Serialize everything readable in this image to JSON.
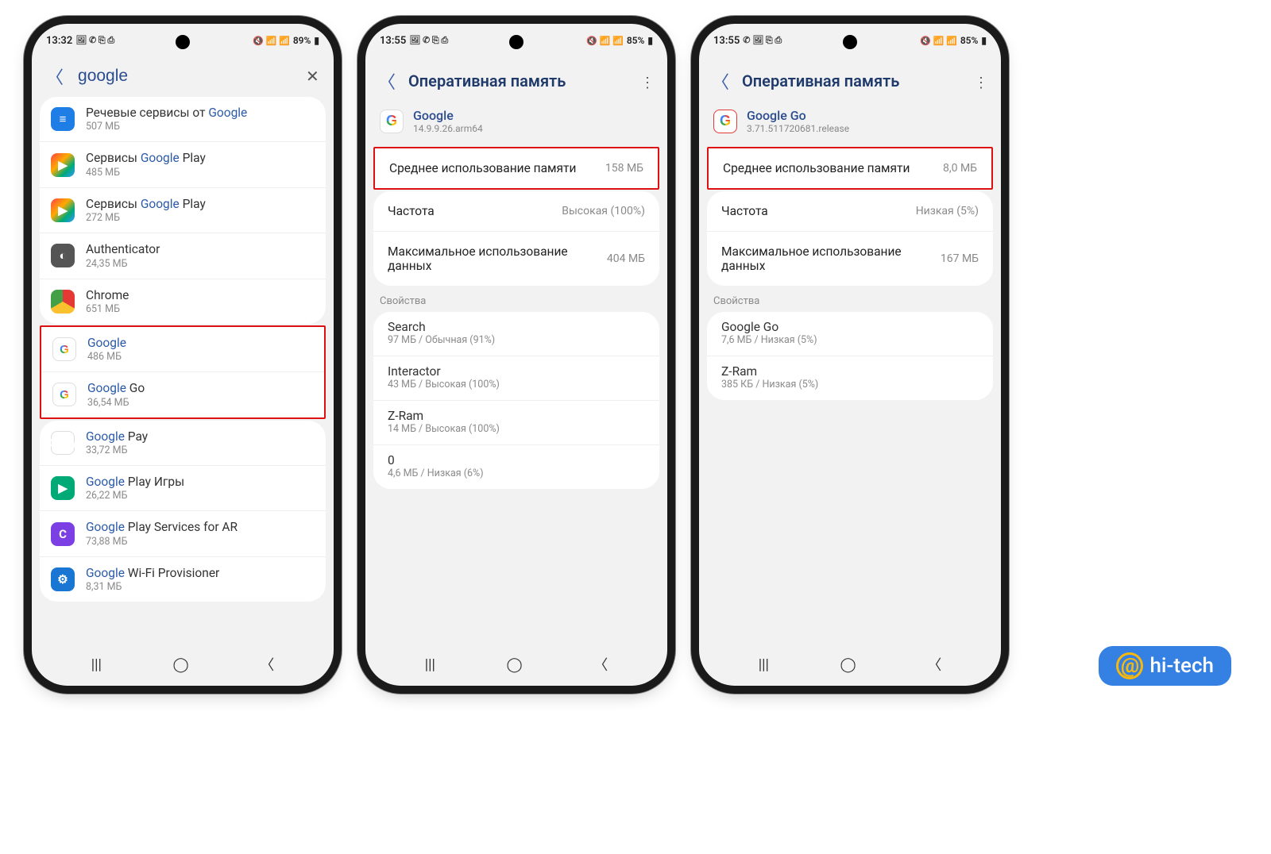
{
  "watermark": "hi-tech",
  "phone1": {
    "status": {
      "time": "13:32",
      "battery": "89%"
    },
    "search": {
      "value": "google"
    },
    "items": [
      {
        "title_pre": "Речевые сервисы от ",
        "title_hl": "Google",
        "title_post": "",
        "sub": "507 МБ",
        "icon": "speech",
        "hl": false
      },
      {
        "title_pre": "Сервисы ",
        "title_hl": "Google",
        "title_post": " Play",
        "sub": "485 МБ",
        "icon": "play",
        "hl": false
      },
      {
        "title_pre": "Сервисы ",
        "title_hl": "Google",
        "title_post": " Play",
        "sub": "272 МБ",
        "icon": "play2",
        "hl": false
      },
      {
        "title_pre": "",
        "title_hl": "",
        "title_post": "Authenticator",
        "sub": "24,35 МБ",
        "icon": "auth",
        "hl": false
      },
      {
        "title_pre": "",
        "title_hl": "",
        "title_post": "Chrome",
        "sub": "651 МБ",
        "icon": "chrome",
        "hl": false
      },
      {
        "title_pre": "",
        "title_hl": "Google",
        "title_post": "",
        "sub": "486 МБ",
        "icon": "google",
        "hl": true
      },
      {
        "title_pre": "",
        "title_hl": "Google",
        "title_post": " Go",
        "sub": "36,54 МБ",
        "icon": "googlego",
        "hl": true
      },
      {
        "title_pre": "",
        "title_hl": "Google",
        "title_post": " Pay",
        "sub": "33,72 МБ",
        "icon": "gpay",
        "hl": false
      },
      {
        "title_pre": "",
        "title_hl": "Google",
        "title_post": " Play Игры",
        "sub": "26,22 МБ",
        "icon": "playg",
        "hl": false
      },
      {
        "title_pre": "",
        "title_hl": "Google",
        "title_post": " Play Services for AR",
        "sub": "73,88 МБ",
        "icon": "ar",
        "hl": false
      },
      {
        "title_pre": "",
        "title_hl": "Google",
        "title_post": " Wi-Fi Provisioner",
        "sub": "8,31 МБ",
        "icon": "prov",
        "hl": false
      }
    ]
  },
  "phone2": {
    "status": {
      "time": "13:55",
      "battery": "85%"
    },
    "title": "Оперативная память",
    "app": {
      "name": "Google",
      "version": "14.9.9.26.arm64"
    },
    "avg": {
      "label": "Среднее использование памяти",
      "value": "158 МБ"
    },
    "freq": {
      "label": "Частота",
      "value": "Высокая (100%)"
    },
    "max": {
      "label": "Максимальное использование данных",
      "value": "404 МБ"
    },
    "section": "Свойства",
    "props": [
      {
        "name": "Search",
        "sub": "97 МБ / Обычная (91%)"
      },
      {
        "name": "Interactor",
        "sub": "43 МБ / Высокая (100%)"
      },
      {
        "name": "Z-Ram",
        "sub": "14 МБ / Высокая (100%)"
      },
      {
        "name": "0",
        "sub": "4,6 МБ / Низкая (6%)"
      }
    ]
  },
  "phone3": {
    "status": {
      "time": "13:55",
      "battery": "85%"
    },
    "title": "Оперативная память",
    "app": {
      "name": "Google Go",
      "version": "3.71.511720681.release"
    },
    "avg": {
      "label": "Среднее использование памяти",
      "value": "8,0 МБ"
    },
    "freq": {
      "label": "Частота",
      "value": "Низкая (5%)"
    },
    "max": {
      "label": "Максимальное использование данных",
      "value": "167 МБ"
    },
    "section": "Свойства",
    "props": [
      {
        "name": "Google Go",
        "sub": "7,6 МБ / Низкая (5%)"
      },
      {
        "name": "Z-Ram",
        "sub": "385 КБ / Низкая (5%)"
      }
    ]
  }
}
